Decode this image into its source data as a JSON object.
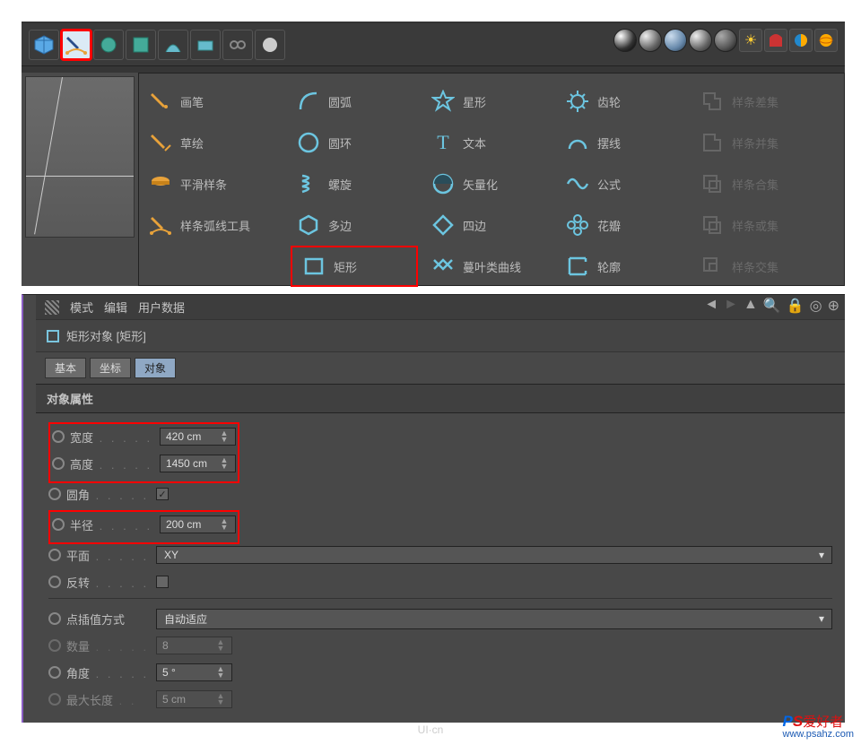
{
  "popup": {
    "col1": [
      {
        "label": "画笔",
        "icon": "pen"
      },
      {
        "label": "草绘",
        "icon": "sketch"
      },
      {
        "label": "平滑样条",
        "icon": "smooth"
      },
      {
        "label": "样条弧线工具",
        "icon": "arc-tool"
      }
    ],
    "col2": [
      {
        "label": "圆弧",
        "icon": "arc"
      },
      {
        "label": "圆环",
        "icon": "circle"
      },
      {
        "label": "螺旋",
        "icon": "helix"
      },
      {
        "label": "多边",
        "icon": "hexagon"
      },
      {
        "label": "矩形",
        "icon": "rect",
        "hl": true
      }
    ],
    "col3": [
      {
        "label": "星形",
        "icon": "star"
      },
      {
        "label": "文本",
        "icon": "text"
      },
      {
        "label": "矢量化",
        "icon": "vectorize"
      },
      {
        "label": "四边",
        "icon": "diamond"
      },
      {
        "label": "蔓叶类曲线",
        "icon": "cissoid"
      }
    ],
    "col4": [
      {
        "label": "齿轮",
        "icon": "gear"
      },
      {
        "label": "摆线",
        "icon": "cycloid"
      },
      {
        "label": "公式",
        "icon": "formula"
      },
      {
        "label": "花瓣",
        "icon": "flower"
      },
      {
        "label": "轮廓",
        "icon": "profile"
      }
    ],
    "col5": [
      {
        "label": "样条差集",
        "icon": "bool1"
      },
      {
        "label": "样条并集",
        "icon": "bool2"
      },
      {
        "label": "样条合集",
        "icon": "bool3"
      },
      {
        "label": "样条或集",
        "icon": "bool4"
      },
      {
        "label": "样条交集",
        "icon": "bool5"
      }
    ]
  },
  "panel_menu": {
    "mode": "模式",
    "edit": "编辑",
    "userdata": "用户数据"
  },
  "obj_title": "矩形对象 [矩形]",
  "tabs": {
    "basic": "基本",
    "coord": "坐标",
    "obj": "对象"
  },
  "section": "对象属性",
  "fields": {
    "width_lbl": "宽度",
    "width_val": "420 cm",
    "height_lbl": "高度",
    "height_val": "1450 cm",
    "round_lbl": "圆角",
    "radius_lbl": "半径",
    "radius_val": "200 cm",
    "plane_lbl": "平面",
    "plane_val": "XY",
    "reverse_lbl": "反转",
    "interp_lbl": "点插值方式",
    "interp_val": "自动适应",
    "count_lbl": "数量",
    "count_val": "8",
    "angle_lbl": "角度",
    "angle_val": "5 °",
    "maxlen_lbl": "最大长度",
    "maxlen_val": "5 cm"
  },
  "watermark": {
    "center": "UI·cn",
    "brand_p": "P",
    "brand_s": "S",
    "brand_txt": "爱好者",
    "url": "www.psahz.com"
  }
}
